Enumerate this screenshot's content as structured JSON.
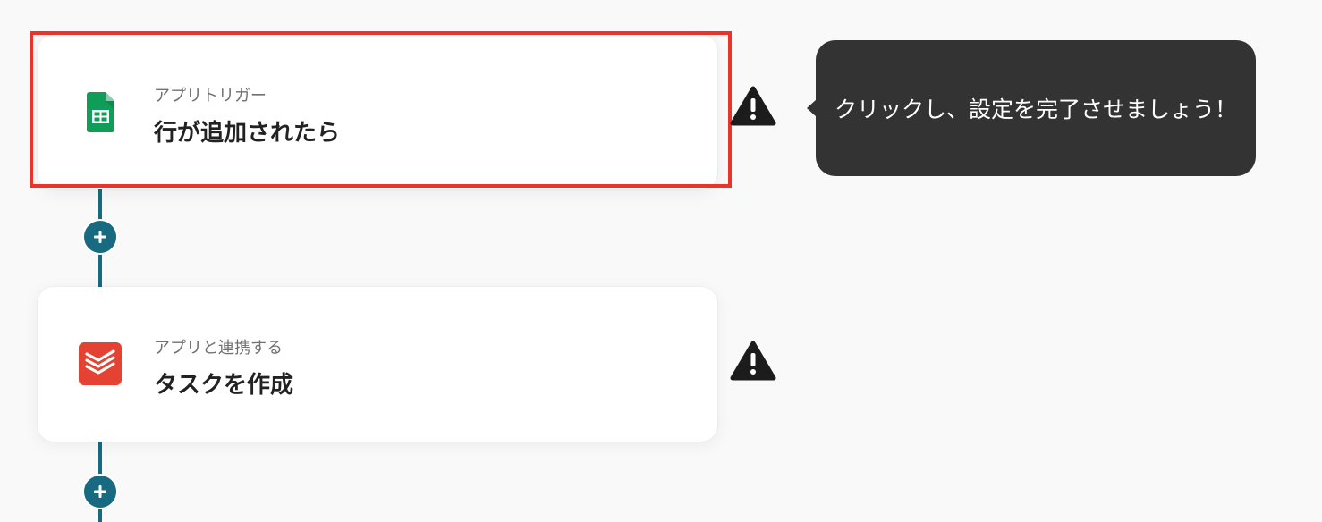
{
  "flow": {
    "steps": [
      {
        "type_label": "アプリトリガー",
        "title": "行が追加されたら",
        "app_icon": "google-sheets-icon"
      },
      {
        "type_label": "アプリと連携する",
        "title": "タスクを作成",
        "app_icon": "todoist-icon"
      }
    ],
    "add_step_icon": "plus-icon",
    "warning_icon": "warning-triangle-icon"
  },
  "tooltip": {
    "text": "クリックし、設定を完了させましょう！"
  },
  "colors": {
    "connector": "#176a80",
    "highlight": "#e8342a",
    "tooltip_bg": "#333333",
    "sheets_green": "#0f9d58",
    "todoist_red": "#e44232"
  }
}
